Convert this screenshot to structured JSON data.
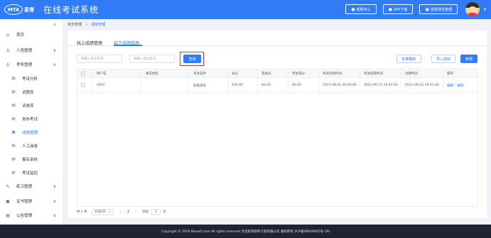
{
  "header": {
    "logo_mark": "MTA",
    "logo_text": "麦塔",
    "title": "在线考试系统",
    "buttons": [
      {
        "icon": "●",
        "label": "帮助中心"
      },
      {
        "icon": "●",
        "label": "APP下载"
      },
      {
        "icon": "▣",
        "label": "登录地址管理"
      }
    ]
  },
  "sidebar": {
    "collapse_icon": "‹",
    "items": [
      {
        "icon": "⌂",
        "label": "首页"
      },
      {
        "icon": "♙",
        "label": "人员管理",
        "arrow": "∨"
      },
      {
        "icon": "♙",
        "label": "考务管理",
        "arrow": "∧"
      },
      {
        "icon": "▤",
        "label": "考试分析"
      },
      {
        "icon": "▤",
        "label": "试题库"
      },
      {
        "icon": "▤",
        "label": "试卷库"
      },
      {
        "icon": "▤",
        "label": "发布考试"
      },
      {
        "icon": "▣",
        "label": "成绩管理"
      },
      {
        "icon": "▤",
        "label": "人工阅卷"
      },
      {
        "icon": "▤",
        "label": "报名审核"
      },
      {
        "icon": "▤",
        "label": "考试监控"
      },
      {
        "icon": "✎",
        "label": "练习管理",
        "arrow": "∨"
      },
      {
        "icon": "▣",
        "label": "证书管理",
        "arrow": "∨"
      },
      {
        "icon": "▤",
        "label": "公告管理",
        "arrow": "∨"
      }
    ]
  },
  "breadcrumb": {
    "parent": "考务管理",
    "sep": ">",
    "current": "成绩管理"
  },
  "tabs": [
    "线上成绩管理",
    "线下成绩管理"
  ],
  "filters": {
    "name_placeholder": "请输入考试名称",
    "id_placeholder": "请输入身份证号",
    "query_label": "查询"
  },
  "actions": {
    "batch_delete": "批量删除",
    "import": "导入成绩",
    "add": "新增"
  },
  "table": {
    "columns": [
      "用户名",
      "真实姓名",
      "考试名称",
      "总分",
      "及格分",
      "考生得分",
      "考试开始时间",
      "考试结束时间",
      "创建时间",
      "操作"
    ],
    "rows": [
      {
        "username": "0001",
        "realname": "",
        "exam": "技能测试",
        "total": "100.00",
        "pass": "60.00",
        "score": "80.00",
        "start": "2021-06-01 00:00:00",
        "end": "2021-06-15 10:41:03",
        "created": "2021-06-15 10:41:06",
        "edit": "编辑",
        "delete": "删除"
      }
    ]
  },
  "pager": {
    "total": "共 1 条",
    "page_size": "10条/页",
    "prev": "‹",
    "current": "1",
    "next": "›",
    "goto_prefix": "前往",
    "goto_value": "1",
    "goto_suffix": "页"
  },
  "footer": "Copyright © 2019 Biosoft.com All rights reserved 大连栋邦软件工程有限公司 版权所有 (ICP备09029045号-19)"
}
